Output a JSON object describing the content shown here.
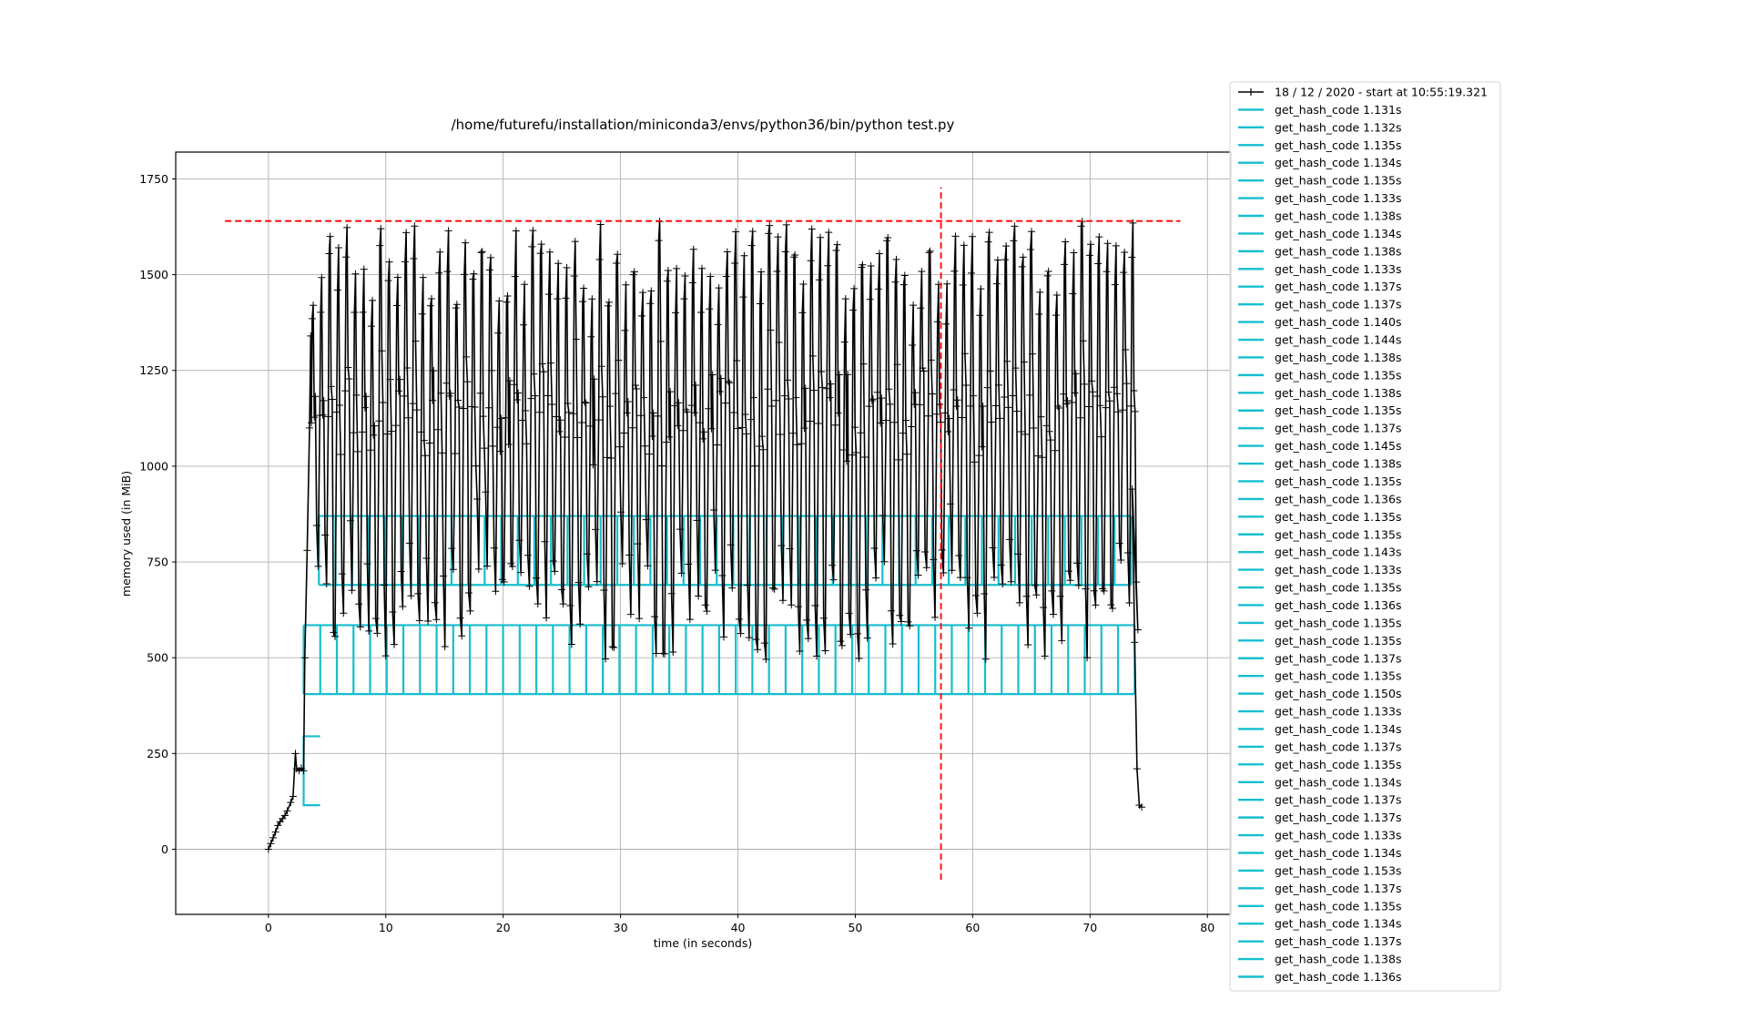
{
  "chart_data": {
    "type": "line",
    "title": "/home/futurefu/installation/miniconda3/envs/python36/bin/python test.py",
    "xlabel": "time (in seconds)",
    "ylabel": "memory used (in MiB)",
    "xlim": [
      -7.9,
      82
    ],
    "ylim": [
      -170,
      1820
    ],
    "xticks": [
      0,
      10,
      20,
      30,
      40,
      50,
      60,
      70,
      80
    ],
    "xtick_labels": [
      "0",
      "10",
      "20",
      "30",
      "40",
      "50",
      "60",
      "70",
      "80"
    ],
    "yticks": [
      0,
      250,
      500,
      750,
      1000,
      1250,
      1500,
      1750
    ],
    "ytick_labels": [
      "0",
      "250",
      "500",
      "750",
      "1000",
      "1250",
      "1500",
      "1750"
    ],
    "grid": true,
    "legend_position": "outside-right",
    "colors": {
      "memory": "#000000",
      "function_bracket": "#17becf",
      "peak_marker": "#ff0000",
      "grid": "#b0b0b0"
    },
    "memory_series": {
      "name": "18 / 12 / 2020 - start at 10:55:19.321",
      "marker": "+",
      "startup_points": [
        [
          0,
          0
        ],
        [
          0.2,
          15
        ],
        [
          0.4,
          30
        ],
        [
          0.6,
          45
        ],
        [
          0.8,
          62
        ],
        [
          1.0,
          72
        ],
        [
          1.2,
          80
        ],
        [
          1.4,
          88
        ],
        [
          1.6,
          100
        ],
        [
          1.9,
          122
        ],
        [
          2.1,
          138
        ],
        [
          2.3,
          250
        ],
        [
          2.4,
          210
        ],
        [
          2.6,
          205
        ],
        [
          2.8,
          212
        ],
        [
          3.0,
          205
        ],
        [
          3.1,
          500
        ],
        [
          3.3,
          780
        ],
        [
          3.5,
          1100
        ],
        [
          3.6,
          1340
        ]
      ],
      "oscillation": {
        "start": 3.6,
        "end": 73.8,
        "period_s": 0.72,
        "peak_range": [
          1420,
          1640
        ],
        "trough_range": [
          490,
          760
        ]
      },
      "tail_points": [
        [
          73.6,
          940
        ],
        [
          73.8,
          540
        ],
        [
          74.0,
          210
        ],
        [
          74.2,
          115
        ],
        [
          74.4,
          110
        ]
      ],
      "max_value": 1640,
      "max_time": 57.3
    },
    "peak_marker": {
      "horizontal": {
        "y": 1640,
        "x_range": [
          -3.7,
          77.7
        ]
      },
      "vertical": {
        "x": 57.3,
        "y_range": [
          -80,
          1728
        ]
      }
    },
    "function_brackets": {
      "first": {
        "start": 3.0,
        "end": 4.4,
        "low": 115,
        "high": 295
      },
      "lower_band": {
        "start": 3.0,
        "end": 73.8,
        "low": 405,
        "high": 585
      },
      "upper_band": {
        "start": 4.3,
        "end": 73.5,
        "low": 690,
        "high": 870
      },
      "cell_width_s": 1.42
    },
    "legend": [
      {
        "label": "18 / 12 / 2020 - start at 10:55:19.321",
        "kind": "memory"
      },
      {
        "label": "get_hash_code 1.131s",
        "kind": "bracket"
      },
      {
        "label": "get_hash_code 1.132s",
        "kind": "bracket"
      },
      {
        "label": "get_hash_code 1.135s",
        "kind": "bracket"
      },
      {
        "label": "get_hash_code 1.134s",
        "kind": "bracket"
      },
      {
        "label": "get_hash_code 1.135s",
        "kind": "bracket"
      },
      {
        "label": "get_hash_code 1.133s",
        "kind": "bracket"
      },
      {
        "label": "get_hash_code 1.138s",
        "kind": "bracket"
      },
      {
        "label": "get_hash_code 1.134s",
        "kind": "bracket"
      },
      {
        "label": "get_hash_code 1.138s",
        "kind": "bracket"
      },
      {
        "label": "get_hash_code 1.133s",
        "kind": "bracket"
      },
      {
        "label": "get_hash_code 1.137s",
        "kind": "bracket"
      },
      {
        "label": "get_hash_code 1.137s",
        "kind": "bracket"
      },
      {
        "label": "get_hash_code 1.140s",
        "kind": "bracket"
      },
      {
        "label": "get_hash_code 1.144s",
        "kind": "bracket"
      },
      {
        "label": "get_hash_code 1.138s",
        "kind": "bracket"
      },
      {
        "label": "get_hash_code 1.135s",
        "kind": "bracket"
      },
      {
        "label": "get_hash_code 1.138s",
        "kind": "bracket"
      },
      {
        "label": "get_hash_code 1.135s",
        "kind": "bracket"
      },
      {
        "label": "get_hash_code 1.137s",
        "kind": "bracket"
      },
      {
        "label": "get_hash_code 1.145s",
        "kind": "bracket"
      },
      {
        "label": "get_hash_code 1.138s",
        "kind": "bracket"
      },
      {
        "label": "get_hash_code 1.135s",
        "kind": "bracket"
      },
      {
        "label": "get_hash_code 1.136s",
        "kind": "bracket"
      },
      {
        "label": "get_hash_code 1.135s",
        "kind": "bracket"
      },
      {
        "label": "get_hash_code 1.135s",
        "kind": "bracket"
      },
      {
        "label": "get_hash_code 1.143s",
        "kind": "bracket"
      },
      {
        "label": "get_hash_code 1.133s",
        "kind": "bracket"
      },
      {
        "label": "get_hash_code 1.135s",
        "kind": "bracket"
      },
      {
        "label": "get_hash_code 1.136s",
        "kind": "bracket"
      },
      {
        "label": "get_hash_code 1.135s",
        "kind": "bracket"
      },
      {
        "label": "get_hash_code 1.135s",
        "kind": "bracket"
      },
      {
        "label": "get_hash_code 1.137s",
        "kind": "bracket"
      },
      {
        "label": "get_hash_code 1.135s",
        "kind": "bracket"
      },
      {
        "label": "get_hash_code 1.150s",
        "kind": "bracket"
      },
      {
        "label": "get_hash_code 1.133s",
        "kind": "bracket"
      },
      {
        "label": "get_hash_code 1.134s",
        "kind": "bracket"
      },
      {
        "label": "get_hash_code 1.137s",
        "kind": "bracket"
      },
      {
        "label": "get_hash_code 1.135s",
        "kind": "bracket"
      },
      {
        "label": "get_hash_code 1.134s",
        "kind": "bracket"
      },
      {
        "label": "get_hash_code 1.137s",
        "kind": "bracket"
      },
      {
        "label": "get_hash_code 1.137s",
        "kind": "bracket"
      },
      {
        "label": "get_hash_code 1.133s",
        "kind": "bracket"
      },
      {
        "label": "get_hash_code 1.134s",
        "kind": "bracket"
      },
      {
        "label": "get_hash_code 1.153s",
        "kind": "bracket"
      },
      {
        "label": "get_hash_code 1.137s",
        "kind": "bracket"
      },
      {
        "label": "get_hash_code 1.135s",
        "kind": "bracket"
      },
      {
        "label": "get_hash_code 1.134s",
        "kind": "bracket"
      },
      {
        "label": "get_hash_code 1.137s",
        "kind": "bracket"
      },
      {
        "label": "get_hash_code 1.138s",
        "kind": "bracket"
      },
      {
        "label": "get_hash_code 1.136s",
        "kind": "bracket"
      }
    ]
  }
}
